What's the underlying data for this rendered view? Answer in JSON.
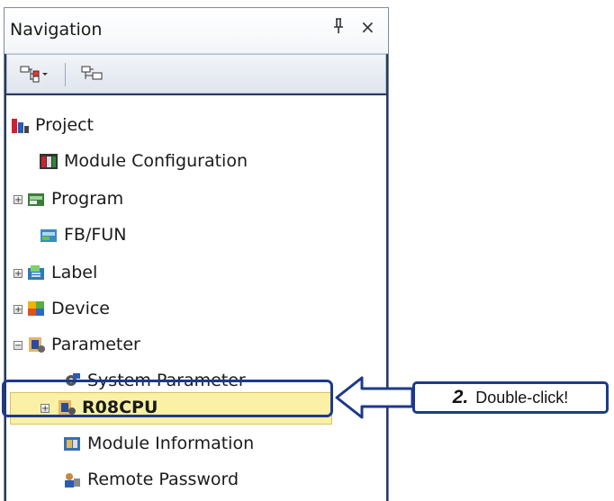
{
  "panel": {
    "title": "Navigation",
    "pin_glyph": "ᚿ",
    "close_glyph": "×"
  },
  "toolbar": {
    "buttons": [
      "expand-collapse-menu-icon",
      "tree-view-icon"
    ]
  },
  "tree": {
    "items": [
      {
        "label": "Project",
        "icon": "project-icon"
      },
      {
        "label": "Module Configuration",
        "icon": "module-configuration-icon"
      },
      {
        "label": "Program",
        "icon": "program-icon",
        "expander": "+"
      },
      {
        "label": "FB/FUN",
        "icon": "fb-fun-icon"
      },
      {
        "label": "Label",
        "icon": "label-icon",
        "expander": "+"
      },
      {
        "label": "Device",
        "icon": "device-icon",
        "expander": "+"
      },
      {
        "label": "Parameter",
        "icon": "parameter-icon",
        "expander": "−"
      },
      {
        "label": "System Parameter",
        "icon": "system-parameter-icon"
      },
      {
        "label": "R08CPU",
        "icon": "cpu-parameter-icon",
        "expander": "+",
        "selected": true
      },
      {
        "label": "Module Information",
        "icon": "module-information-icon"
      },
      {
        "label": "Remote Password",
        "icon": "remote-password-icon"
      }
    ]
  },
  "callout": {
    "step": "2.",
    "text": "Double-click!",
    "color": "#1d3a8a"
  },
  "colors": {
    "selection": "#fbf1a6",
    "panel_border": "#253a5e"
  }
}
